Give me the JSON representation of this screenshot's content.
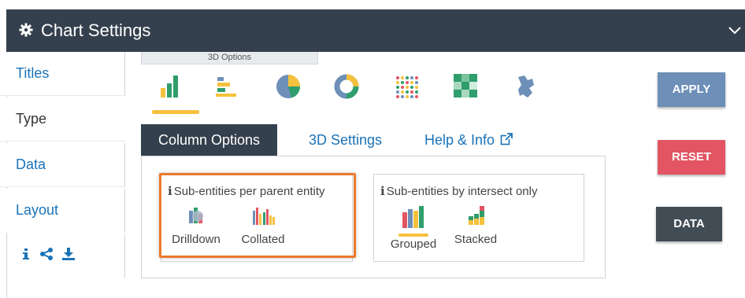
{
  "header": {
    "title": "Chart Settings",
    "gear_icon": "gear-icon",
    "collapse_icon": "chevron-down-icon"
  },
  "sidebar": {
    "items": [
      {
        "label": "Titles",
        "active": false
      },
      {
        "label": "Type",
        "active": true
      },
      {
        "label": "Data",
        "active": false
      },
      {
        "label": "Layout",
        "active": false
      }
    ],
    "actions": [
      "info-icon",
      "share-icon",
      "download-icon"
    ]
  },
  "options_tab": {
    "label": "3D Options"
  },
  "chart_types": [
    {
      "name": "column-chart-icon",
      "selected": true
    },
    {
      "name": "bar-chart-icon",
      "selected": false
    },
    {
      "name": "pie-chart-icon",
      "selected": false
    },
    {
      "name": "donut-chart-icon",
      "selected": false
    },
    {
      "name": "dot-matrix-icon",
      "selected": false
    },
    {
      "name": "heatmap-icon",
      "selected": false
    },
    {
      "name": "map-icon",
      "selected": false
    }
  ],
  "tabs": [
    {
      "label": "Column Options",
      "active": true
    },
    {
      "label": "3D Settings",
      "active": false
    },
    {
      "label": "Help & Info",
      "active": false,
      "icon": "external-link-icon"
    }
  ],
  "groups": {
    "per_parent": {
      "title": "Sub-entities per parent entity",
      "options": [
        {
          "label": "Drilldown"
        },
        {
          "label": "Collated"
        }
      ]
    },
    "intersect": {
      "title": "Sub-entities by intersect only",
      "options": [
        {
          "label": "Grouped",
          "selected": true
        },
        {
          "label": "Stacked"
        }
      ]
    }
  },
  "buttons": {
    "apply": "APPLY",
    "reset": "RESET",
    "data": "DATA"
  },
  "colors": {
    "header_bg": "#35404e",
    "accent_yellow": "#f5c13d",
    "highlight_orange": "#ec7a2e",
    "apply": "#6d8fb8",
    "reset": "#e35562",
    "data": "#424c55",
    "link": "#1a73b8"
  }
}
